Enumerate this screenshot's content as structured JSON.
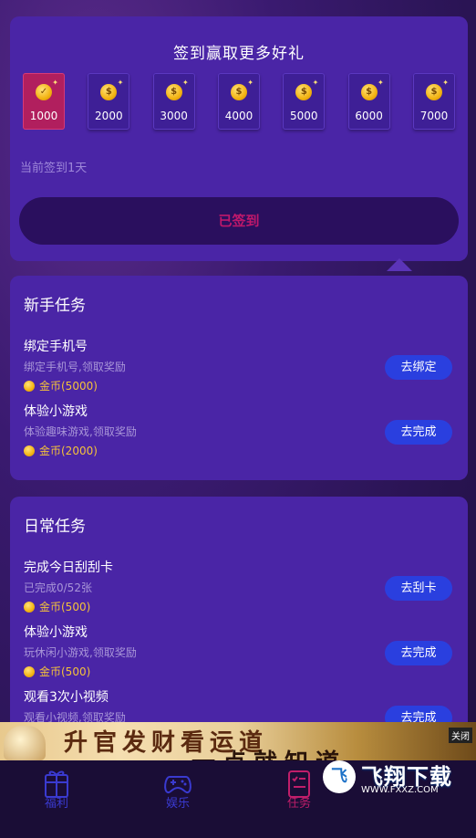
{
  "signin": {
    "title": "签到赢取更多好礼",
    "days": [
      {
        "value": "1000",
        "done": true
      },
      {
        "value": "2000",
        "done": false
      },
      {
        "value": "3000",
        "done": false
      },
      {
        "value": "4000",
        "done": false
      },
      {
        "value": "5000",
        "done": false
      },
      {
        "value": "6000",
        "done": false
      },
      {
        "value": "7000",
        "done": false
      }
    ],
    "streak": "当前签到1天",
    "button": "已签到",
    "coin_glyph": "$"
  },
  "newbie": {
    "title": "新手任务",
    "tasks": [
      {
        "name": "绑定手机号",
        "desc": "绑定手机号,领取奖励",
        "reward": "金币(5000)",
        "button": "去绑定"
      },
      {
        "name": "体验小游戏",
        "desc": "体验趣味游戏,领取奖励",
        "reward": "金币(2000)",
        "button": "去完成"
      }
    ]
  },
  "daily": {
    "title": "日常任务",
    "tasks": [
      {
        "name": "完成今日刮刮卡",
        "desc": "已完成0/52张",
        "reward": "金币(500)",
        "button": "去刮卡"
      },
      {
        "name": "体验小游戏",
        "desc": "玩休闲小游戏,领取奖励",
        "reward": "金币(500)",
        "button": "去完成"
      },
      {
        "name": "观看3次小视频",
        "desc": "观看小视频,领取奖励",
        "reward": "",
        "button": "去完成"
      }
    ]
  },
  "ad": {
    "line1": "升官发财看运道",
    "line2": "一点就知道",
    "close": "关闭",
    "logo_badge": "飞",
    "logo_text": "飞翔下载",
    "logo_sub": "WWW.FXXZ.COM"
  },
  "tabbar": {
    "tabs": [
      {
        "label": "福利",
        "icon": "gift-icon"
      },
      {
        "label": "娱乐",
        "icon": "gamepad-icon"
      },
      {
        "label": "任务",
        "icon": "task-list-icon",
        "active": true
      }
    ]
  },
  "colors": {
    "accent": "#c01e6a",
    "button_blue": "#2a3fdf",
    "card": "#4a25a6",
    "coin": "#f5c23a"
  }
}
